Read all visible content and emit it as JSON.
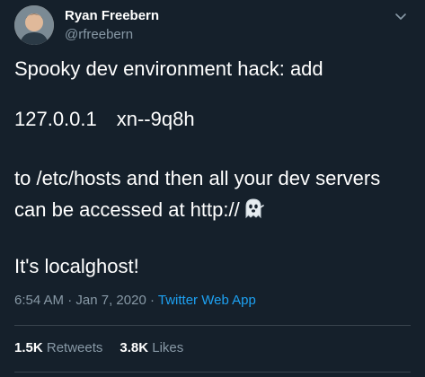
{
  "user": {
    "name": "Ryan Freebern",
    "handle": "@rfreebern"
  },
  "tweet": {
    "line1": "Spooky dev environment hack: add",
    "ip": "127.0.0.1",
    "host": "xn--9q8h",
    "line3": "to /etc/hosts and then all your dev servers",
    "line4": "can be accessed at http://",
    "line5": "It's localghost!"
  },
  "meta": {
    "time": "6:54 AM",
    "sep1": "·",
    "date": "Jan 7, 2020",
    "sep2": "·",
    "source": "Twitter Web App"
  },
  "stats": {
    "retweets_count": "1.5K",
    "retweets_label": "Retweets",
    "likes_count": "3.8K",
    "likes_label": "Likes"
  },
  "icons": {
    "avatar": "avatar-photo",
    "caret": "chevron-down-icon",
    "emoji": "ghost-icon"
  },
  "colors": {
    "background": "#15202b",
    "text": "#ffffff",
    "secondary": "#8899a6",
    "link": "#1da1f2",
    "divider": "#38444d"
  }
}
